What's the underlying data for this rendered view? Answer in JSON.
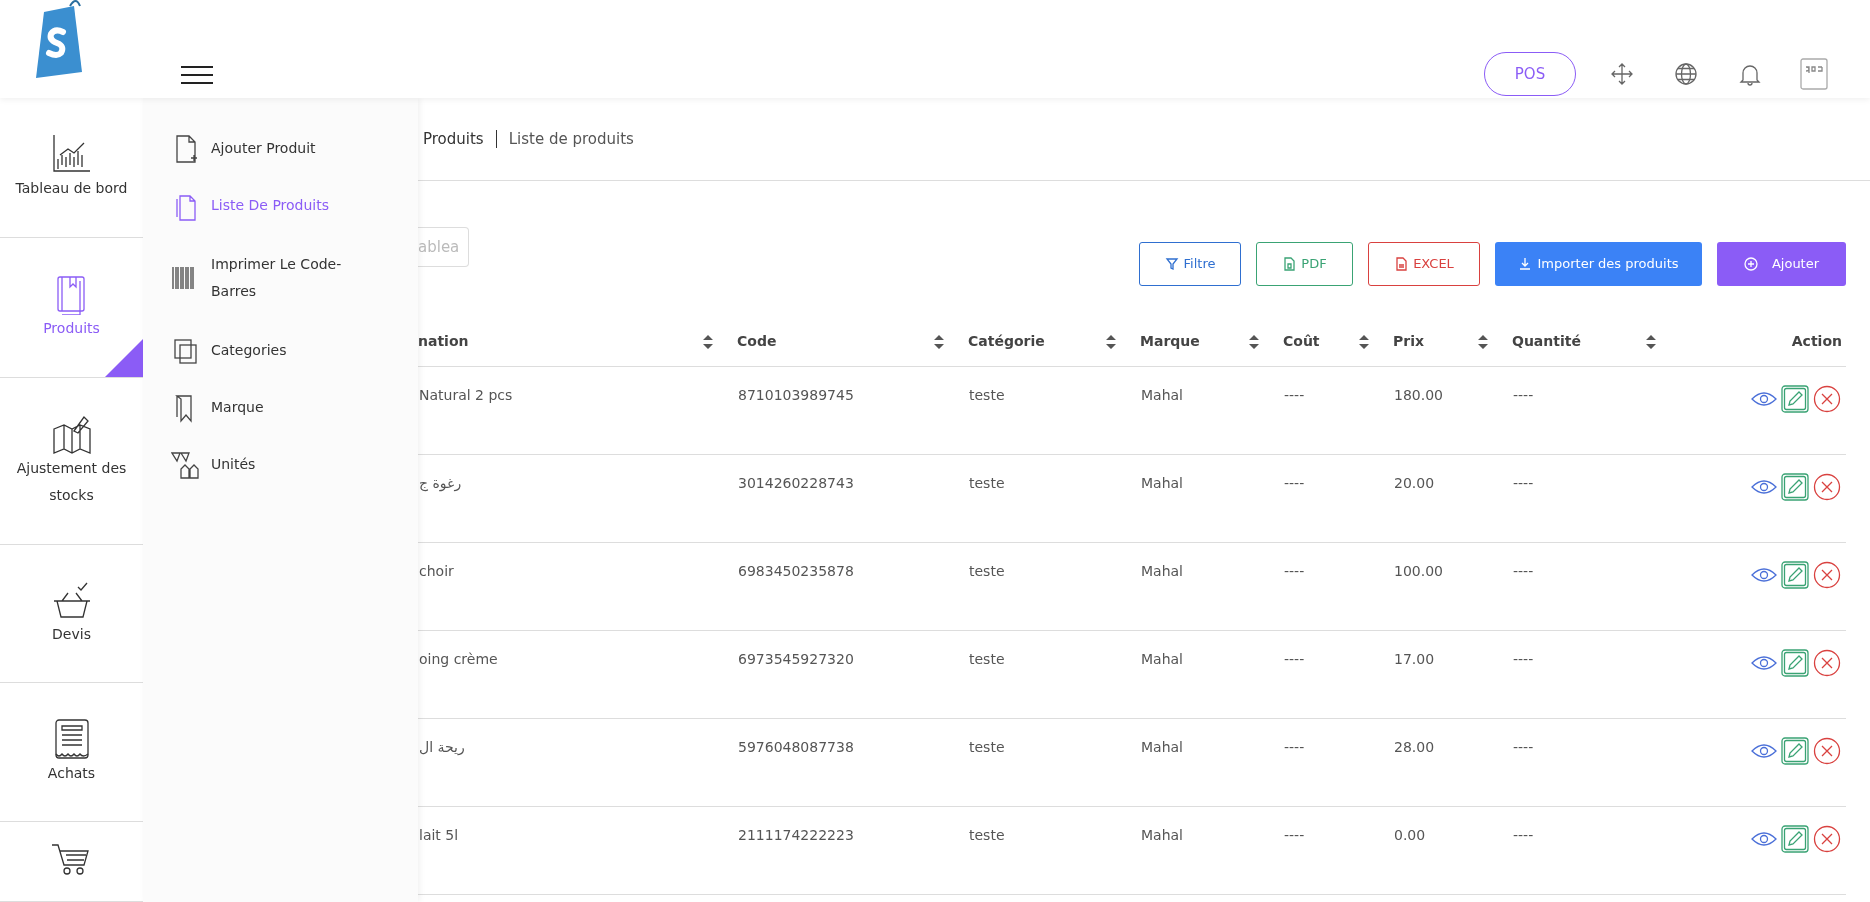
{
  "header": {
    "pos_button": "POS"
  },
  "sidebar": {
    "items": [
      {
        "label": "Tableau de bord",
        "selected": false
      },
      {
        "label": "Produits",
        "selected": true
      },
      {
        "label": "Ajustement des stocks",
        "selected": false
      },
      {
        "label": "Devis",
        "selected": false
      },
      {
        "label": "Achats",
        "selected": false
      },
      {
        "selected": false
      }
    ]
  },
  "submenu": {
    "items": [
      {
        "label": "Ajouter Produit",
        "selected": false
      },
      {
        "label": "Liste De Produits",
        "selected": true
      },
      {
        "label": "Imprimer Le Code-Barres",
        "selected": false
      },
      {
        "label": "Categories",
        "selected": false
      },
      {
        "label": "Marque",
        "selected": false
      },
      {
        "label": "Unités",
        "selected": false
      }
    ]
  },
  "breadcrumb": [
    "Produits",
    "Liste de produits"
  ],
  "search": {
    "placeholder": "ablea"
  },
  "toolbar": [
    {
      "label": "Filtre",
      "kind": "filter"
    },
    {
      "label": "PDF",
      "kind": "pdf"
    },
    {
      "label": "EXCEL",
      "kind": "excel"
    },
    {
      "label": "Importer des produits",
      "kind": "import"
    },
    {
      "label": "Ajouter",
      "kind": "add"
    }
  ],
  "table": {
    "columns": [
      {
        "label": "nation",
        "sortable": true
      },
      {
        "label": "Code",
        "sortable": true
      },
      {
        "label": "Catégorie",
        "sortable": true
      },
      {
        "label": "Marque",
        "sortable": true
      },
      {
        "label": "Coût",
        "sortable": true
      },
      {
        "label": "Prix",
        "sortable": true
      },
      {
        "label": "Quantité",
        "sortable": true
      },
      {
        "label": "Action",
        "sortable": false
      }
    ],
    "rows": [
      [
        "Natural 2 pcs",
        "8710103989745",
        "teste",
        "Mahal",
        "----",
        "180.00",
        "----"
      ],
      [
        "رغوة ج",
        "3014260228743",
        "teste",
        "Mahal",
        "----",
        "20.00",
        "----"
      ],
      [
        "choir",
        "6983450235878",
        "teste",
        "Mahal",
        "----",
        "100.00",
        "----"
      ],
      [
        "oing crème",
        "6973545927320",
        "teste",
        "Mahal",
        "----",
        "17.00",
        "----"
      ],
      [
        "ريحة ال",
        "5976048087738",
        "teste",
        "Mahal",
        "----",
        "28.00",
        "----"
      ],
      [
        "lait 5l",
        "2111174222223",
        "teste",
        "Mahal",
        "----",
        "0.00",
        "----"
      ]
    ]
  }
}
